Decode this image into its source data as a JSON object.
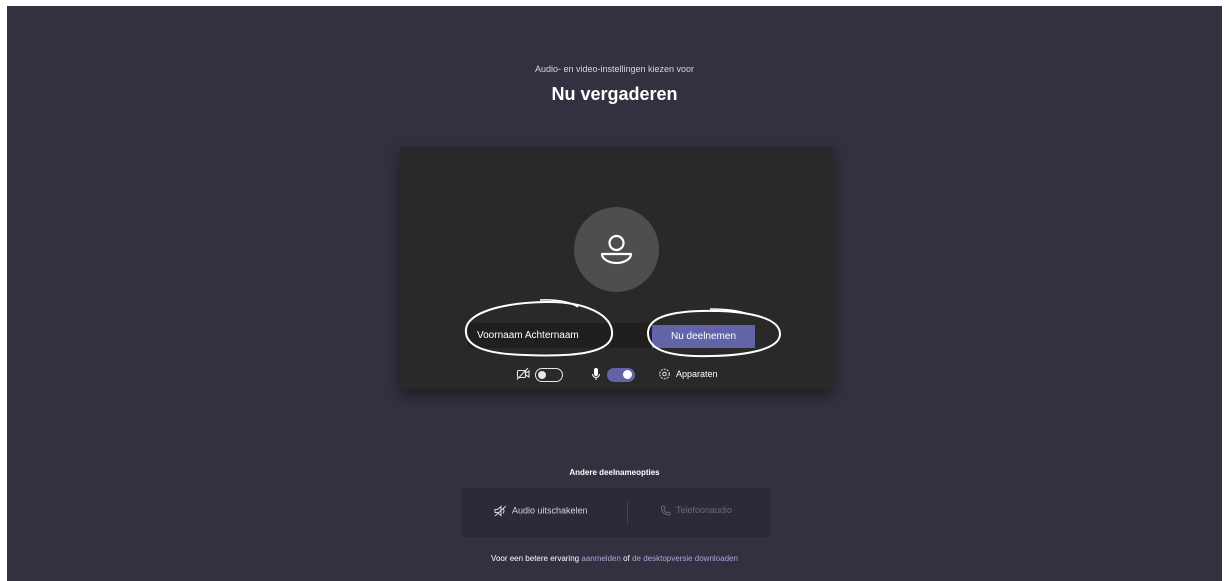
{
  "header": {
    "subtitle": "Audio- en video-instellingen kiezen voor",
    "title": "Nu vergaderen"
  },
  "preview": {
    "name_value": "Voornaam Achternaam",
    "join_label": "Nu deelnemen",
    "camera_toggle_on": false,
    "mic_toggle_on": true,
    "devices_label": "Apparaten",
    "accent_color": "#6264a7"
  },
  "other_options": {
    "title": "Andere deelnameopties",
    "audio_off_label": "Audio uitschakelen",
    "phone_audio_label": "Telefoonaudio"
  },
  "footer": {
    "prefix": "Voor een betere ervaring",
    "signin_link": "aanmelden",
    "middle": "of",
    "download_link": "de desktopversie downloaden"
  },
  "icons": [
    "person-icon",
    "camera-off-icon",
    "microphone-icon",
    "gear-icon",
    "speaker-off-icon",
    "phone-icon"
  ]
}
